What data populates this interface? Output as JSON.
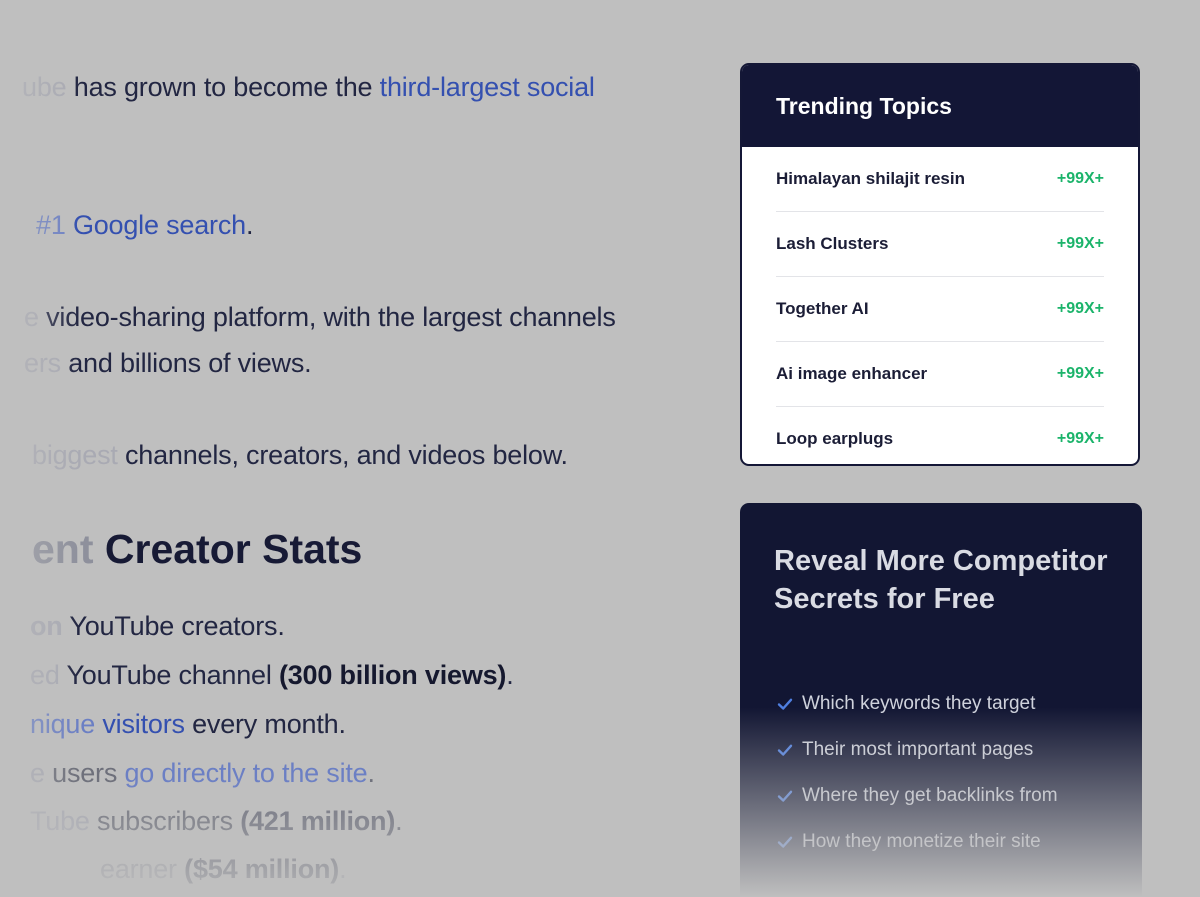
{
  "article": {
    "line1": {
      "pre": "ube",
      "text": " has grown to become the ",
      "link": "third-largest social"
    },
    "line2": {
      "pre": "#1 ",
      "link": "Google search",
      "post": "."
    },
    "line3": {
      "pre": "e",
      "text": " video-sharing platform, with the largest channels"
    },
    "line4": {
      "pre": "ers",
      "text": " and billions of views."
    },
    "line5": {
      "pre": "biggest",
      "text": " channels, creators, and videos below."
    },
    "heading": {
      "pre": "ent",
      "text": " Creator Stats"
    },
    "stat1": {
      "pre": "on",
      "text": " YouTube creators."
    },
    "stat2": {
      "pre": "ed",
      "text": " YouTube channel ",
      "bold": "(300 billion views)",
      "post": "."
    },
    "stat3": {
      "pre": "nique ",
      "link": "visitors",
      "text": " every month."
    },
    "stat4": {
      "pre": "e",
      "text": " users ",
      "link": "go directly to the site",
      "post": "."
    },
    "stat5": {
      "pre": "Tube",
      "text": " subscribers ",
      "bold": "(421 million)",
      "post": "."
    },
    "stat6": {
      "text": "earner ",
      "bold": "($54 million)",
      "post": "."
    }
  },
  "trending": {
    "title": "Trending Topics",
    "items": [
      {
        "name": "Himalayan shilajit resin",
        "value": "+99X+"
      },
      {
        "name": "Lash Clusters",
        "value": "+99X+"
      },
      {
        "name": "Together AI",
        "value": "+99X+"
      },
      {
        "name": "Ai image enhancer",
        "value": "+99X+"
      },
      {
        "name": "Loop earplugs",
        "value": "+99X+"
      }
    ]
  },
  "reveal": {
    "title": "Reveal More Competitor Secrets for Free",
    "items": [
      "Which keywords they target",
      "Their most important pages",
      "Where they get backlinks from",
      "How they monetize their site"
    ]
  },
  "colors": {
    "background": "#bfbfbf",
    "navy": "#131636",
    "link": "#3450b0",
    "positive": "#1cb46b"
  },
  "icons": {
    "check": "check-icon"
  }
}
